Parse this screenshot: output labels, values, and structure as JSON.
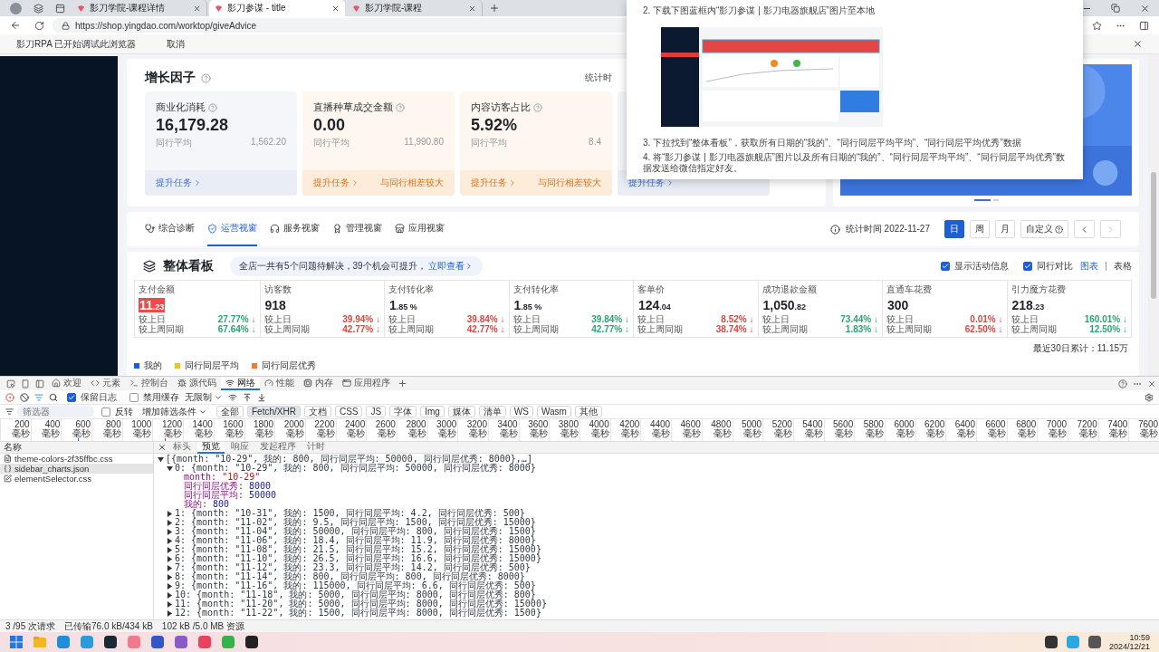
{
  "browser": {
    "tabs": [
      {
        "title": "影刀学院-课程详情",
        "selected": false
      },
      {
        "title": "影刀参谋 - title",
        "selected": true
      },
      {
        "title": "影刀学院-课程",
        "selected": false
      }
    ],
    "url": "https://shop.yingdao.com/worktop/giveAdvice",
    "infobar": {
      "message": "影刀RPA 已开始调试此浏览器",
      "action": "取消"
    }
  },
  "popup": {
    "items": [
      {
        "kind": "text",
        "text": "2. 下载下图蓝框内“影刀参谋 | 影刀电器旗舰店”图片至本地"
      },
      {
        "kind": "picture"
      },
      {
        "kind": "text",
        "text": "3. 下拉找到“整体看板”，获取所有日期的“我的”、“同行同层平均平均”、“同行同层平均优秀”数据"
      },
      {
        "kind": "text",
        "text": "4. 将“影刀参谋 | 影刀电器旗舰店”图片以及所有日期的“我的”、“同行同层平均平均”、“同行同层平均优秀”数据发送给微信指定好友。"
      }
    ]
  },
  "growth": {
    "title": "增长因子",
    "stat_label": "统计时",
    "cards": [
      {
        "kind": "normal",
        "title": "商业化消耗",
        "value": "16,179.28",
        "peer_label": "同行平均",
        "peer_value": "1,562.20",
        "link": "提升任务"
      },
      {
        "kind": "warning",
        "title": "直播种草成交金额",
        "value": "0.00",
        "peer_label": "同行平均",
        "peer_value": "11,990.80",
        "link": "提升任务",
        "note": "与同行相差较大"
      },
      {
        "kind": "warning",
        "title": "内容访客占比",
        "value": "5.92%",
        "peer_label": "同行平均",
        "peer_value": "8.4",
        "link": "提升任务",
        "note": "与同行相差较大"
      },
      {
        "kind": "normal",
        "link": "提升任务"
      }
    ]
  },
  "nav": {
    "tabs": [
      {
        "label": "综合诊断",
        "selected": false
      },
      {
        "label": "运营视窗",
        "selected": true
      },
      {
        "label": "服务视窗",
        "selected": false
      },
      {
        "label": "管理视窗",
        "selected": false
      },
      {
        "label": "应用视窗",
        "selected": false
      }
    ],
    "stat": "统计时间 2022-11-27",
    "periods": [
      {
        "label": "日",
        "selected": true
      },
      {
        "label": "周",
        "selected": false
      },
      {
        "label": "月",
        "selected": false
      },
      {
        "label": "自定义",
        "selected": false
      }
    ]
  },
  "board": {
    "title": "整体看板",
    "notice": "全店一共有5个问题待解决，39个机会可提升，",
    "notice_link": "立即查看",
    "options": [
      {
        "label": "显示活动信息",
        "checked": true
      },
      {
        "label": "同行对比",
        "checked": true
      }
    ],
    "views": [
      {
        "label": "图表",
        "selected": true
      },
      {
        "label": "表格",
        "selected": false
      }
    ],
    "metrics": [
      {
        "name": "支付金额",
        "int": "11",
        "dec": ".23",
        "highlighted": true,
        "changes": [
          {
            "label": "较上日",
            "value": "27.77%",
            "arrow": "↓",
            "color": "#2ba471"
          },
          {
            "label": "较上周同期",
            "value": "67.64%",
            "arrow": "↓",
            "color": "#2ba471"
          }
        ]
      },
      {
        "name": "访客数",
        "int": "918",
        "highlighted": false,
        "changes": [
          {
            "label": "较上日",
            "value": "39.94%",
            "arrow": "↓",
            "color": "#d54941"
          },
          {
            "label": "较上周同期",
            "value": "42.77%",
            "arrow": "↓",
            "color": "#d54941"
          }
        ]
      },
      {
        "name": "支付转化率",
        "int": "1",
        "dec": ".85 %",
        "highlighted": false,
        "changes": [
          {
            "label": "较上日",
            "value": "39.84%",
            "arrow": "↓",
            "color": "#d54941"
          },
          {
            "label": "较上周同期",
            "value": "42.77%",
            "arrow": "↓",
            "color": "#d54941"
          }
        ]
      },
      {
        "name": "支付转化率",
        "int": "1",
        "dec": ".85 %",
        "highlighted": false,
        "changes": [
          {
            "label": "较上日",
            "value": "39.84%",
            "arrow": "↓",
            "color": "#2ba471"
          },
          {
            "label": "较上周同期",
            "value": "42.77%",
            "arrow": "↓",
            "color": "#2ba471"
          }
        ]
      },
      {
        "name": "客单价",
        "int": "124",
        "dec": ".04",
        "highlighted": false,
        "changes": [
          {
            "label": "较上日",
            "value": "8.52%",
            "arrow": "↓",
            "color": "#d54941"
          },
          {
            "label": "较上周同期",
            "value": "38.74%",
            "arrow": "↓",
            "color": "#d54941"
          }
        ]
      },
      {
        "name": "成功退款金额",
        "int": "1,050",
        "dec": ".82",
        "highlighted": false,
        "changes": [
          {
            "label": "较上日",
            "value": "73.44%",
            "arrow": "↓",
            "color": "#2ba471"
          },
          {
            "label": "较上周同期",
            "value": "1.83%",
            "arrow": "↓",
            "color": "#2ba471"
          }
        ]
      },
      {
        "name": "直通车花费",
        "int": "300",
        "highlighted": false,
        "changes": [
          {
            "label": "较上日",
            "value": "0.01%",
            "arrow": "↓",
            "color": "#d54941"
          },
          {
            "label": "较上周同期",
            "value": "62.50%",
            "arrow": "↓",
            "color": "#d54941"
          }
        ]
      },
      {
        "name": "引力魔方花费",
        "int": "218",
        "dec": ".23",
        "highlighted": false,
        "changes": [
          {
            "label": "较上日",
            "value": "160.01%",
            "arrow": "↓",
            "color": "#2ba471"
          },
          {
            "label": "较上周同期",
            "value": "12.50%",
            "arrow": "↓",
            "color": "#2ba471"
          }
        ]
      }
    ],
    "total": "最近30日累计：11.15万",
    "legend": [
      {
        "label": "我的",
        "color": "#1d5fd6"
      },
      {
        "label": "同行同层平均",
        "color": "#f2c21b"
      },
      {
        "label": "同行同层优秀",
        "color": "#ee7b2f"
      }
    ]
  },
  "devtools": {
    "tabs": [
      {
        "label": "欢迎",
        "kind": "home",
        "selected": false
      },
      {
        "label": "元素",
        "kind": "code",
        "selected": false
      },
      {
        "label": "控制台",
        "kind": "console",
        "selected": false
      },
      {
        "label": "源代码",
        "kind": "bug",
        "selected": false
      },
      {
        "label": "网络",
        "kind": "network",
        "selected": true
      },
      {
        "label": "性能",
        "kind": "gauge",
        "selected": false
      },
      {
        "label": "内存",
        "kind": "chip",
        "selected": false
      },
      {
        "label": "应用程序",
        "kind": "app",
        "selected": false
      }
    ],
    "preserve_log": {
      "label": "保留日志",
      "checked": true
    },
    "disable_cache": {
      "label": "禁用缓存",
      "checked": false
    },
    "throttle": "无限制",
    "filter": {
      "placeholder": "筛选器",
      "invert": {
        "label": "反转",
        "checked": false
      },
      "more": "增加筛选条件",
      "types": [
        {
          "label": "全部",
          "selected": false
        },
        {
          "label": "Fetch/XHR",
          "selected": true
        },
        {
          "label": "文档",
          "selected": false
        },
        {
          "label": "CSS",
          "selected": false
        },
        {
          "label": "JS",
          "selected": false
        },
        {
          "label": "字体",
          "selected": false
        },
        {
          "label": "Img",
          "selected": false
        },
        {
          "label": "媒体",
          "selected": false
        },
        {
          "label": "清单",
          "selected": false
        },
        {
          "label": "WS",
          "selected": false
        },
        {
          "label": "Wasm",
          "selected": false
        },
        {
          "label": "其他",
          "selected": false
        }
      ]
    },
    "ticks": [
      "200 毫秒",
      "400 毫秒",
      "600 毫秒",
      "800 毫秒",
      "1000 毫秒",
      "1200 毫秒",
      "1400 毫秒",
      "1600 毫秒",
      "1800 毫秒",
      "2000 毫秒",
      "2200 毫秒",
      "2400 毫秒",
      "2600 毫秒",
      "2800 毫秒",
      "3000 毫秒",
      "3200 毫秒",
      "3400 毫秒",
      "3600 毫秒",
      "3800 毫秒",
      "4000 毫秒",
      "4200 毫秒",
      "4400 毫秒",
      "4600 毫秒",
      "4800 毫秒",
      "5000 毫秒",
      "5200 毫秒",
      "5400 毫秒",
      "5600 毫秒",
      "5800 毫秒",
      "6000 毫秒",
      "6200 毫秒",
      "6400 毫秒",
      "6600 毫秒",
      "6800 毫秒",
      "7000 毫秒",
      "7200 毫秒",
      "7400 毫秒",
      "7600 毫秒"
    ],
    "requests": {
      "header": "名称",
      "files": [
        {
          "name": "theme-colors-2f35ffbc.css",
          "kind": "stylesheet",
          "selected": false
        },
        {
          "name": "sidebar_charts.json",
          "kind": "json",
          "selected": true
        },
        {
          "name": "elementSelector.css",
          "kind": "edit",
          "selected": false
        }
      ]
    },
    "detail_tabs": [
      {
        "label": "标头",
        "selected": false
      },
      {
        "label": "预览",
        "selected": true
      },
      {
        "label": "响应",
        "selected": false
      },
      {
        "label": "发起程序",
        "selected": false
      },
      {
        "label": "计时",
        "selected": false
      }
    ],
    "tree": {
      "label": "[{month: \"10-29\", 我的: 800, 同行同层平均: 50000, 同行同层优秀: 8000},…]",
      "expanded": true,
      "children": [
        {
          "label": "0: {month: \"10-29\", 我的: 800, 同行同层平均: 50000, 同行同层优秀: 8000}",
          "expanded": true,
          "children": [
            {
              "kind": "property",
              "key": "month:",
              "value": "\"10-29\""
            },
            {
              "kind": "property",
              "key": "同行同层优秀:",
              "value": "8000"
            },
            {
              "kind": "property",
              "key": "同行同层平均:",
              "value": "50000"
            },
            {
              "kind": "property",
              "key": "我的:",
              "value": "800"
            }
          ]
        },
        {
          "label": "1: {month: \"10-31\", 我的: 1500, 同行同层平均: 4.2, 同行同层优秀: 500}",
          "expanded": false
        },
        {
          "label": "2: {month: \"11-02\", 我的: 9.5, 同行同层平均: 1500, 同行同层优秀: 15000}",
          "expanded": false
        },
        {
          "label": "3: {month: \"11-04\", 我的: 50000, 同行同层平均: 800, 同行同层优秀: 1500}",
          "expanded": false
        },
        {
          "label": "4: {month: \"11-06\", 我的: 18.4, 同行同层平均: 11.9, 同行同层优秀: 8000}",
          "expanded": false
        },
        {
          "label": "5: {month: \"11-08\", 我的: 21.5, 同行同层平均: 15.2, 同行同层优秀: 15000}",
          "expanded": false
        },
        {
          "label": "6: {month: \"11-10\", 我的: 26.5, 同行同层平均: 16.6, 同行同层优秀: 15000}",
          "expanded": false
        },
        {
          "label": "7: {month: \"11-12\", 我的: 23.3, 同行同层平均: 14.2, 同行同层优秀: 500}",
          "expanded": false
        },
        {
          "label": "8: {month: \"11-14\", 我的: 800, 同行同层平均: 800, 同行同层优秀: 8000}",
          "expanded": false
        },
        {
          "label": "9: {month: \"11-16\", 我的: 115000, 同行同层平均: 6.6, 同行同层优秀: 500}",
          "expanded": false
        },
        {
          "label": "10: {month: \"11-18\", 我的: 5000, 同行同层平均: 8000, 同行同层优秀: 800}",
          "expanded": false
        },
        {
          "label": "11: {month: \"11-20\", 我的: 5000, 同行同层平均: 8000, 同行同层优秀: 15000}",
          "expanded": false
        },
        {
          "label": "12: {month: \"11-22\", 我的: 1500, 同行同层平均: 8000, 同行同层优秀: 1500}",
          "expanded": false
        }
      ]
    },
    "status": [
      "3 /95 次请求",
      "已传输76.0 kB/434 kB",
      "102 kB /5.0 MB 资源"
    ]
  },
  "taskbar": {
    "time": "10:59",
    "date": "2024/12/21"
  }
}
